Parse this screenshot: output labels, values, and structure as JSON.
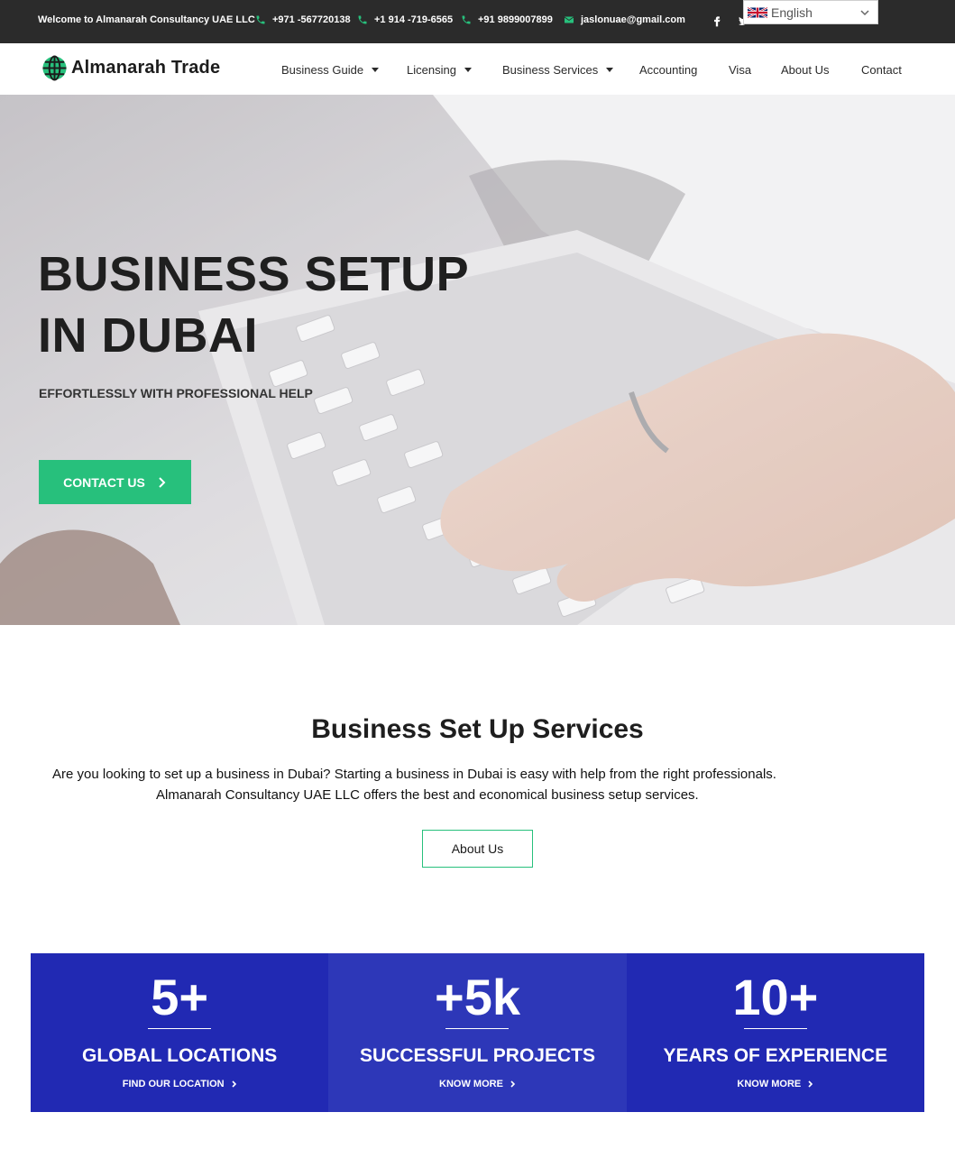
{
  "topbar": {
    "welcome": "Welcome to Almanarah Consultancy UAE LLC",
    "phone1": "+971 -567720138",
    "phone2": "+1 914 -719-6565",
    "phone3": "+91 9899007899",
    "email": "jaslonuae@gmail.com",
    "social_icons": [
      "facebook-icon",
      "twitter-icon",
      "instagram-icon",
      "pinterest-icon"
    ],
    "language": "English"
  },
  "nav": {
    "logo_text": "Almanarah Trade",
    "items": [
      {
        "label": "Business Guide",
        "dropdown": true
      },
      {
        "label": "Licensing",
        "dropdown": true
      },
      {
        "label": "Business Services",
        "dropdown": true
      },
      {
        "label": "Accounting",
        "dropdown": false
      },
      {
        "label": "Visa",
        "dropdown": false
      },
      {
        "label": "About Us",
        "dropdown": false
      },
      {
        "label": "Contact",
        "dropdown": false
      }
    ]
  },
  "hero": {
    "title_line1": "BUSINESS SETUP",
    "title_line2": "IN DUBAI",
    "subtitle": "EFFORTLESSLY WITH PROFESSIONAL HELP",
    "cta": "CONTACT US"
  },
  "services": {
    "title": "Business Set Up Services",
    "text_line1": "Are you looking to set up a business in Dubai? Starting a business in Dubai is easy with help from the right professionals.",
    "text_line2": "Almanarah Consultancy UAE LLC offers the best and economical business setup services.",
    "button": "About Us"
  },
  "stats": [
    {
      "number": "5+",
      "label": "GLOBAL LOCATIONS",
      "link": "FIND OUR LOCATION"
    },
    {
      "number": "+5k",
      "label": "SUCCESSFUL PROJECTS",
      "link": "KNOW MORE"
    },
    {
      "number": "10+",
      "label": "YEARS OF EXPERIENCE",
      "link": "KNOW MORE"
    }
  ],
  "colors": {
    "accent_green": "#27c07c",
    "stats_blue": "#2129b3",
    "topbar_dark": "#2b2b2b"
  }
}
